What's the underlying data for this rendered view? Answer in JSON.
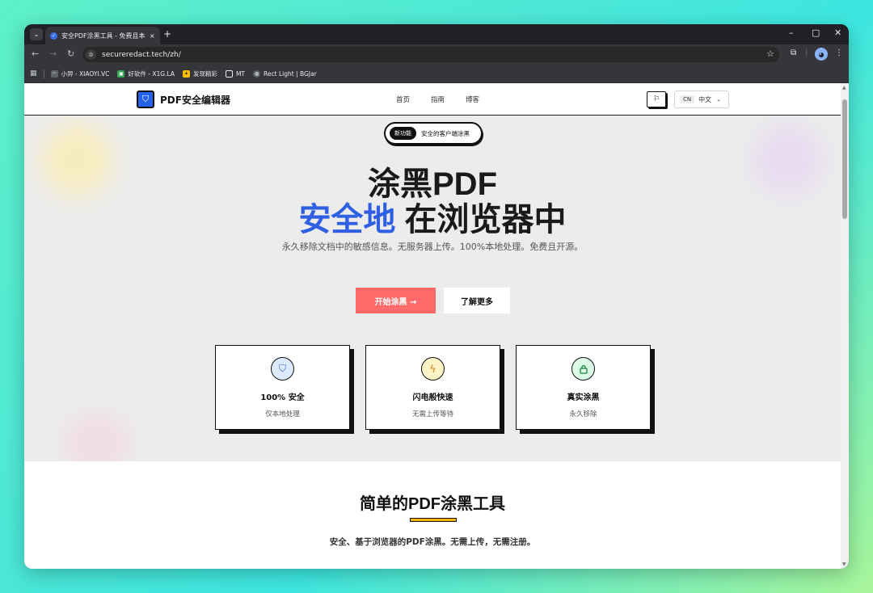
{
  "browser": {
    "tab_title": "安全PDF涂黑工具 - 免费且本地",
    "tab_close": "×",
    "new_tab": "+",
    "url": "securered act.tech/zh/",
    "bookmarks": [
      {
        "label": "小羿 - XIAOYI.VC",
        "icon": "headphones-icon",
        "color": "#5f6368"
      },
      {
        "label": "好软件 - X1G.LA",
        "icon": "app-icon",
        "color": "#34a853"
      },
      {
        "label": "发现精彩",
        "icon": "sparkle-icon",
        "color": "#fbbc04"
      },
      {
        "label": "MT",
        "icon": "folder-icon",
        "color": "#35363a"
      },
      {
        "label": "Rect Light | BGJar",
        "icon": "globe-icon",
        "color": "#5f6368"
      }
    ]
  },
  "header": {
    "logo_text": "PDF安全编辑器",
    "nav": [
      "首页",
      "指南",
      "博客"
    ],
    "lang_code": "CN",
    "lang_label": "中文"
  },
  "hero": {
    "badge_pill": "新功能",
    "badge_text": "安全的客户端涂黑",
    "title_line1": "涂黑PDF",
    "title_accent": "安全地",
    "title_line2_rest": " 在浏览器中",
    "subtitle": "永久移除文档中的敏感信息。无服务器上传。100%本地处理。免费且开源。",
    "primary_button": "开始涂黑 →",
    "secondary_button": "了解更多"
  },
  "features": [
    {
      "title": "100% 安全",
      "desc": "仅本地处理",
      "icon": "shield-icon",
      "color": "#dbeafe",
      "glyph": "⛉"
    },
    {
      "title": "闪电般快速",
      "desc": "无需上传等待",
      "icon": "lightning-icon",
      "color": "#fef3c7",
      "glyph": "ϟ"
    },
    {
      "title": "真实涂黑",
      "desc": "永久移除",
      "icon": "lock-icon",
      "color": "#dcfce7",
      "glyph": "🔒"
    }
  ],
  "section2": {
    "title": "简单的PDF涂黑工具",
    "desc": "安全、基于浏览器的PDF涂黑。无需上传，无需注册。"
  },
  "colors": {
    "accent_blue": "#2f5fe3",
    "primary_button": "#ff6b6b",
    "highlight_yellow": "#fcd34d"
  }
}
